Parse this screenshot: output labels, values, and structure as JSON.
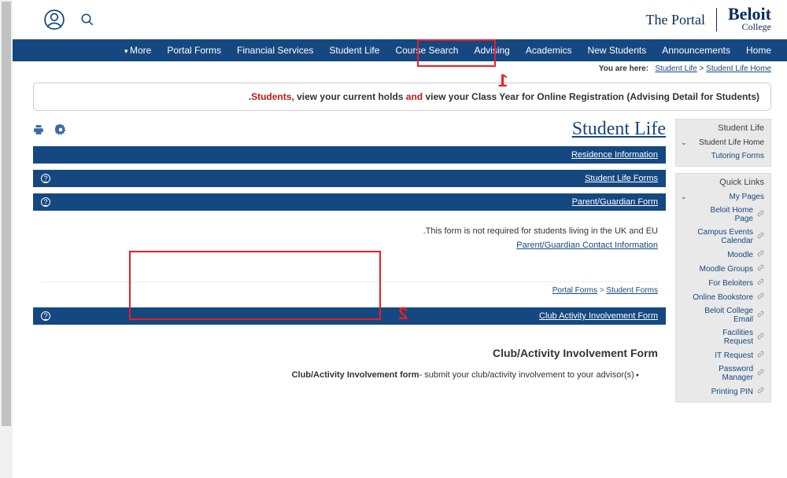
{
  "header": {
    "logo_main": "Beloit",
    "logo_sub": "College",
    "logo_portal": "The Portal"
  },
  "nav": {
    "items": [
      "Home",
      "Announcements",
      "New Students",
      "Academics",
      "Advising",
      "Course Search",
      "Student Life",
      "Financial Services",
      "Portal Forms",
      "More"
    ]
  },
  "breadcrumb": {
    "label": "You are here:",
    "part1": "Student Life",
    "sep": ">",
    "part2": "Student Life Home"
  },
  "alert": {
    "lead": "Students,",
    "t1": " view your current holds ",
    "and": "and",
    "t2": " view your Class Year for Online Registration (Advising Detail for Students)."
  },
  "sidebar": {
    "block1": {
      "head": "Student Life",
      "items": [
        {
          "label": "Student Life Home",
          "active": true,
          "chev": true
        },
        {
          "label": "Tutoring Forms"
        }
      ]
    },
    "block2": {
      "head": "Quick Links",
      "items": [
        {
          "label": "My Pages",
          "chev": true,
          "noicon": true
        },
        {
          "label": "Beloit Home Page"
        },
        {
          "label": "Campus Events Calendar"
        },
        {
          "label": "Moodle"
        },
        {
          "label": "Moodle Groups"
        },
        {
          "label": "For Beloiters"
        },
        {
          "label": "Online Bookstore"
        },
        {
          "label": "Beloit College Email"
        },
        {
          "label": "Facilities Request"
        },
        {
          "label": "IT Request"
        },
        {
          "label": "Password Manager"
        },
        {
          "label": "Printing PIN"
        }
      ]
    }
  },
  "main": {
    "title": "Student Life",
    "panels": {
      "residence": "Residence Information",
      "slforms": "Student Life Forms",
      "parent": {
        "title": "Parent/Guardian Form",
        "note": "This form is not required for students living in the UK and EU.",
        "link": "Parent/Guardian Contact Information",
        "bc_a": "Portal Forms",
        "bc_sep": " > ",
        "bc_b": "Student Forms"
      },
      "club": {
        "title": "Club Activity Involvement Form",
        "heading": "Club/Activity Involvement Form",
        "bullet_b": "Club/Activity Involvement form",
        "bullet_t": "- submit your club/activity involvement to your advisor(s)"
      }
    }
  },
  "annotations": {
    "one": "1",
    "two": "2"
  }
}
